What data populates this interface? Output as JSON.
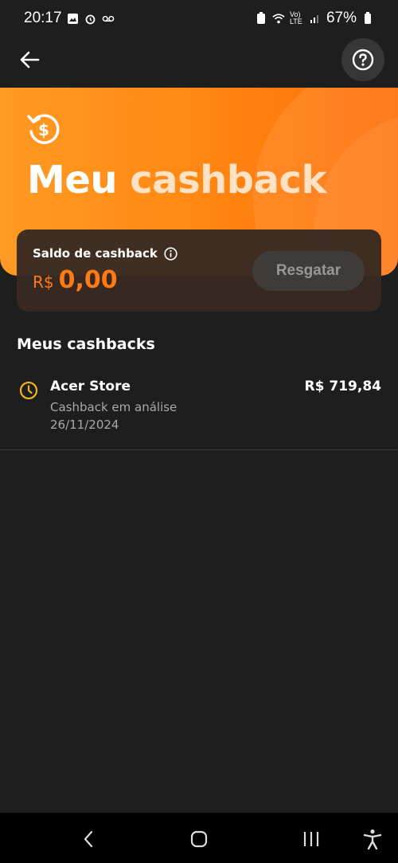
{
  "status_bar": {
    "time": "20:17",
    "battery": "67%",
    "network": "Vo) LTE"
  },
  "header": {
    "back_label": "back",
    "help_label": "help"
  },
  "hero": {
    "title_part1": "Meu",
    "title_part2": "cashback"
  },
  "balance": {
    "label": "Saldo de cashback",
    "currency": "R$",
    "amount": "0,00",
    "redeem_label": "Resgatar"
  },
  "section": {
    "title": "Meus cashbacks"
  },
  "cashbacks": [
    {
      "store": "Acer Store",
      "status": "Cashback em análise",
      "date": "26/11/2024",
      "amount": "R$ 719,84"
    }
  ],
  "colors": {
    "accent": "#ff7a14",
    "hero_start": "#ff9a24",
    "hero_end": "#ff6d05",
    "pending": "#f2b417"
  },
  "icons": [
    "back-arrow-icon",
    "help-icon",
    "cashback-refresh-icon",
    "info-icon",
    "clock-icon",
    "nav-back-icon",
    "nav-home-icon",
    "nav-recents-icon",
    "accessibility-icon"
  ]
}
